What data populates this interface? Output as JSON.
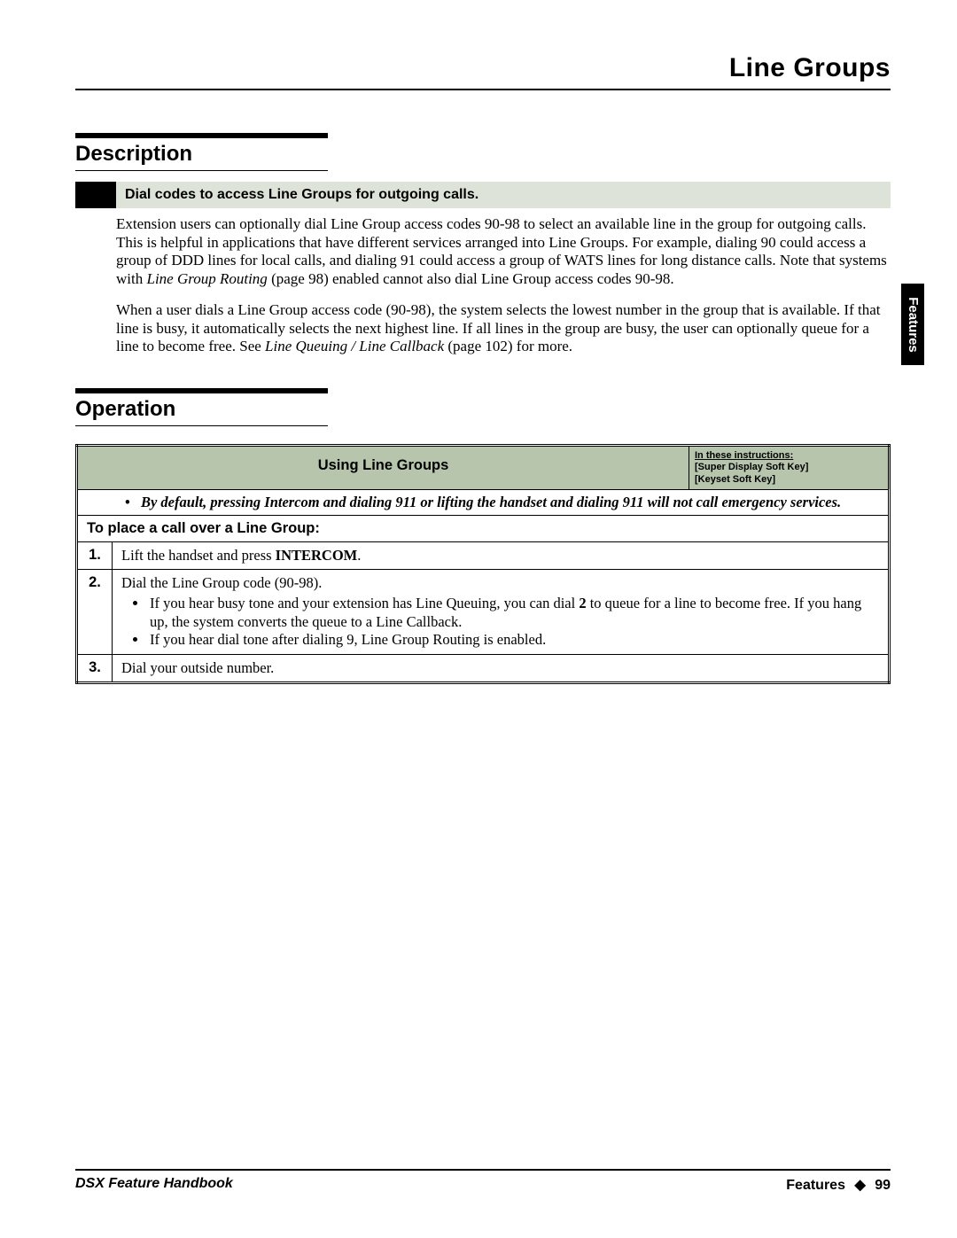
{
  "header": {
    "title": "Line Groups"
  },
  "side_tab": "Features",
  "sections": {
    "description": {
      "title": "Description",
      "callout": "Dial codes to access Line Groups for outgoing calls.",
      "para1_a": "Extension users can optionally dial Line Group access codes 90-98 to select an available line in the group for outgoing calls. This is helpful in applications that have different services arranged into Line Groups. For example, dialing 90 could access a group of DDD lines for local calls, and dialing 91 could access a group of WATS lines for long distance calls. Note that systems with ",
      "para1_ref": "Line Group Routing",
      "para1_b": " (page 98) enabled cannot also dial Line Group access codes 90-98.",
      "para2_a": "When a user dials a Line Group access code (90-98), the system selects the lowest number in the group that is available. If that line is busy, it automatically selects the next highest line. If all lines in the group are busy, the user can optionally queue for a line to become free. See ",
      "para2_ref": "Line Queuing / Line Callback",
      "para2_b": " (page 102) for more."
    },
    "operation": {
      "title": "Operation",
      "table": {
        "hdr_main": "Using Line Groups",
        "hdr_notes_u": "In these instructions:",
        "hdr_notes_l1": "[Super Display Soft Key]",
        "hdr_notes_l2": "[Keyset Soft Key]",
        "warning_a": "•  By default, pressing Intercom and dialing 911 or lifting the handset and dialing 911 will not call emergency services.",
        "subhdr": "To place a call over a Line Group:",
        "steps": [
          {
            "num": "1.",
            "line_a": "Lift the handset and press ",
            "line_bold": "INTERCOM",
            "line_b": "."
          },
          {
            "num": "2.",
            "line_a": "Dial the Line Group code (90-98).",
            "bullets": [
              {
                "a": "If you hear busy tone and your extension has Line Queuing, you can dial ",
                "bold": "2",
                "b": " to queue for a line to become free. If you hang up, the system converts the queue to a Line Callback."
              },
              {
                "a": "If you hear dial tone after dialing 9, Line Group Routing is enabled."
              }
            ]
          },
          {
            "num": "3.",
            "line_a": "Dial your outside number."
          }
        ]
      }
    }
  },
  "footer": {
    "left": "DSX Feature Handbook",
    "right_label": "Features",
    "right_page": "99"
  }
}
